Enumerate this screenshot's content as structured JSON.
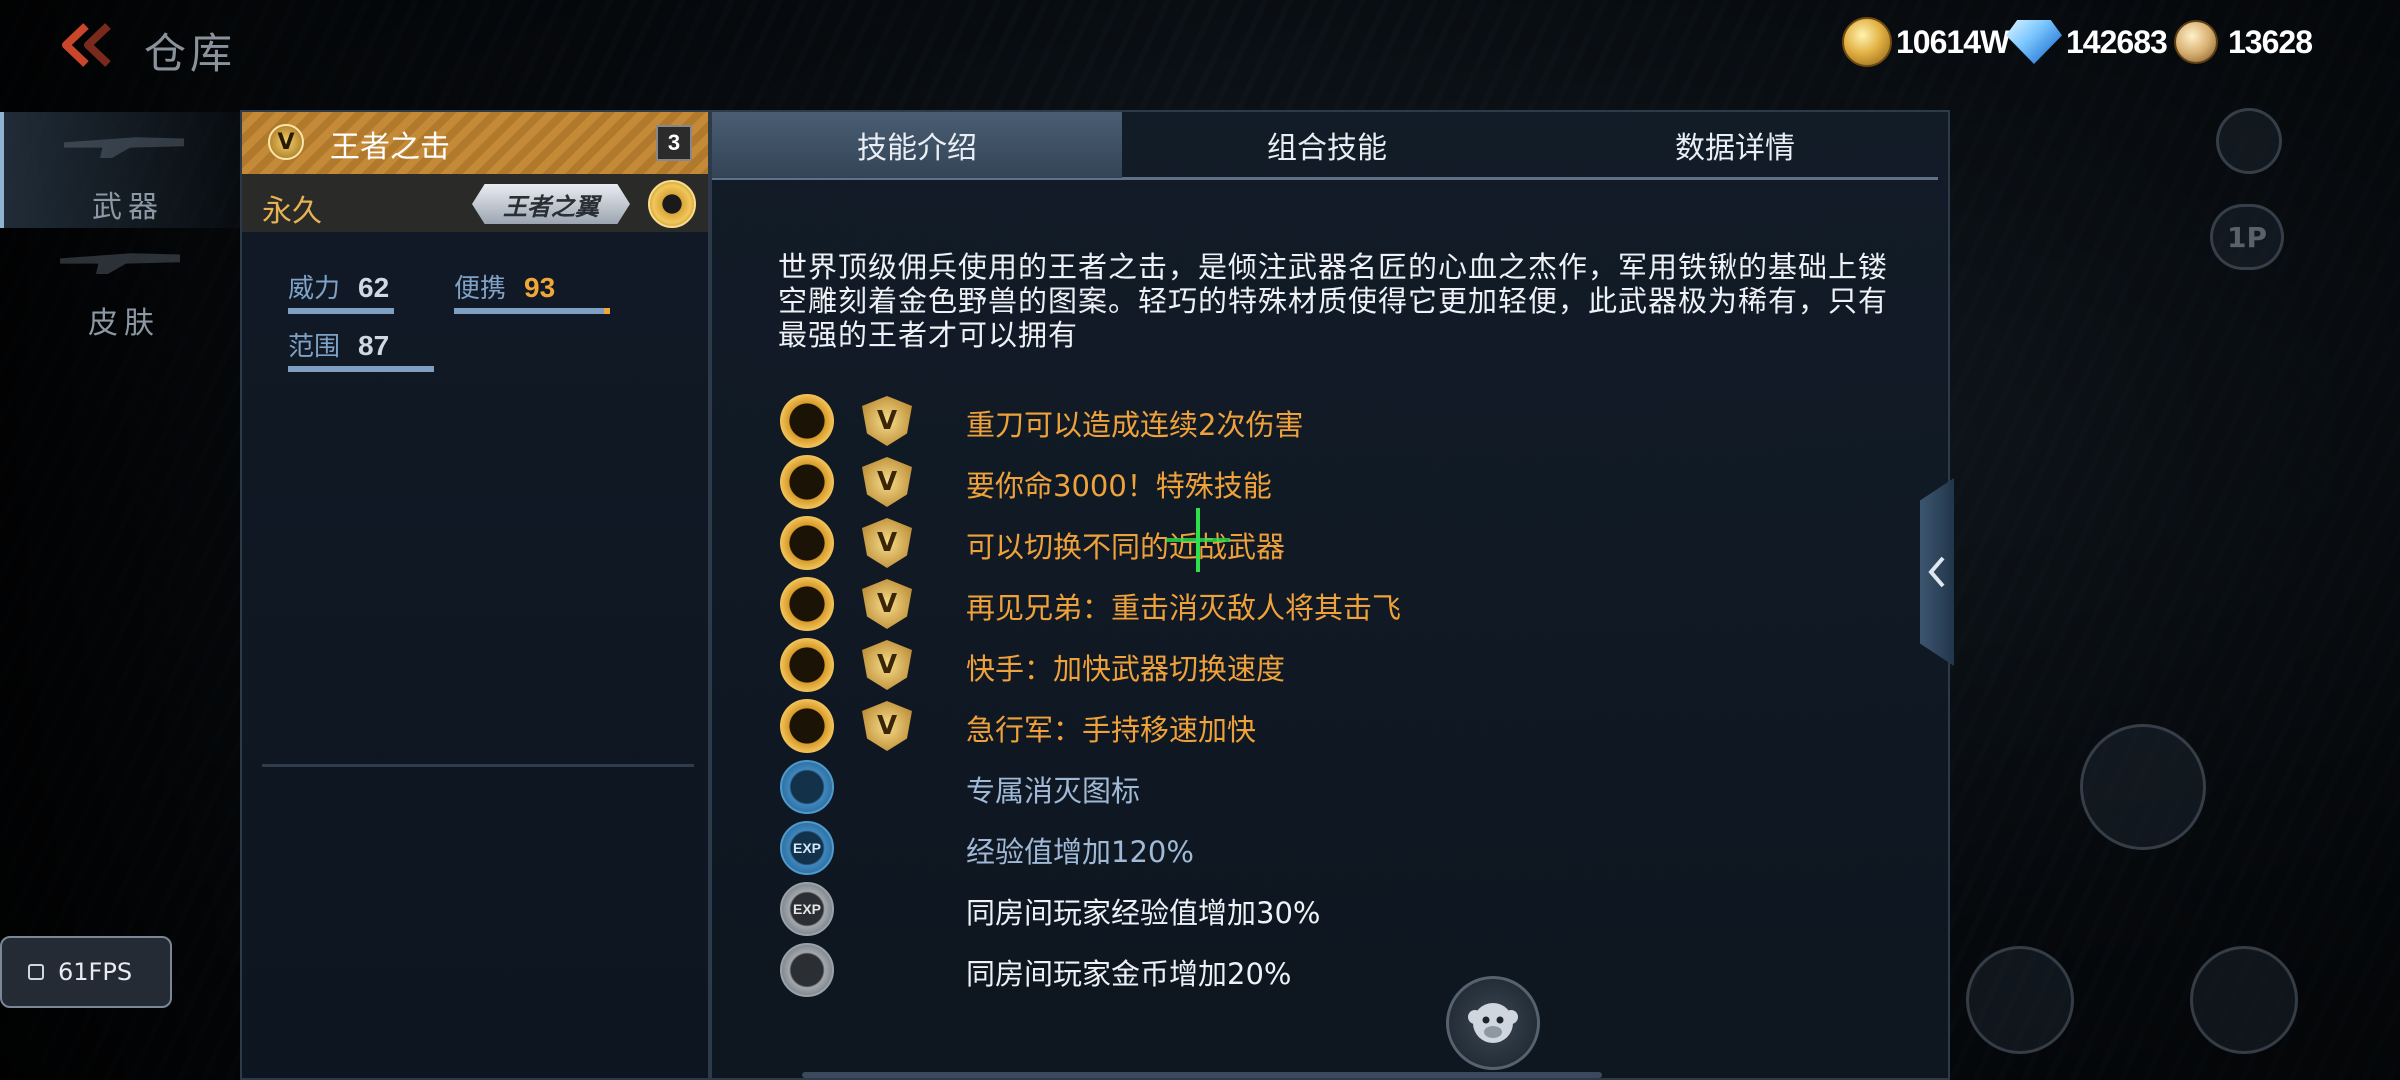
{
  "header": {
    "title": "仓库"
  },
  "currencies": [
    {
      "name": "gold",
      "value": "10614W"
    },
    {
      "name": "diamond",
      "value": "142683"
    },
    {
      "name": "honor",
      "value": "13628"
    }
  ],
  "rail": {
    "items": [
      {
        "label": "武器",
        "active": true
      },
      {
        "label": "皮肤",
        "active": false
      }
    ]
  },
  "weapon": {
    "badge": "V",
    "name": "王者之击",
    "level": "3",
    "duration": "永久",
    "plaque": "王者之翼",
    "stats": {
      "power_label": "威力",
      "power_value": "62",
      "portability_label": "便携",
      "portability_value": "93",
      "range_label": "范围",
      "range_value": "87"
    }
  },
  "tabs": [
    {
      "label": "技能介绍",
      "active": true
    },
    {
      "label": "组合技能",
      "active": false
    },
    {
      "label": "数据详情",
      "active": false
    }
  ],
  "description": "世界顶级佣兵使用的王者之击，是倾注武器名匠的心血之杰作，军用铁锹的基础上镂空雕刻着金色野兽的图案。轻巧的特殊材质使得它更加轻便，此武器极为稀有，只有最强的王者才可以拥有",
  "skills": [
    {
      "icon": "heavy-blade-icon",
      "text": "重刀可以造成连续2次伤害",
      "color": "gold"
    },
    {
      "icon": "heavy-blade-icon",
      "text": "要你命3000！特殊技能",
      "color": "gold"
    },
    {
      "icon": "heavy-blade-icon",
      "text": "可以切换不同的近战武器",
      "color": "gold"
    },
    {
      "icon": "knockback-icon",
      "text": "再见兄弟：重击消灭敌人将其击飞",
      "color": "gold"
    },
    {
      "icon": "quick-hand-icon",
      "text": "快手：加快武器切换速度",
      "color": "gold"
    },
    {
      "icon": "running-man-icon",
      "text": "急行军：手持移速加快",
      "color": "gold"
    },
    {
      "icon": "kill-icon-badge",
      "text": "专属消灭图标",
      "color": "blue"
    },
    {
      "icon": "exp-icon",
      "text": "经验值增加120%",
      "color": "blue"
    },
    {
      "icon": "room-exp-icon",
      "text": "同房间玩家经验值增加30%",
      "color": "white"
    },
    {
      "icon": "room-coin-icon",
      "text": "同房间玩家金币增加20%",
      "color": "white"
    }
  ],
  "fps": "61FPS",
  "side_controls": {
    "view_label": "1P"
  }
}
